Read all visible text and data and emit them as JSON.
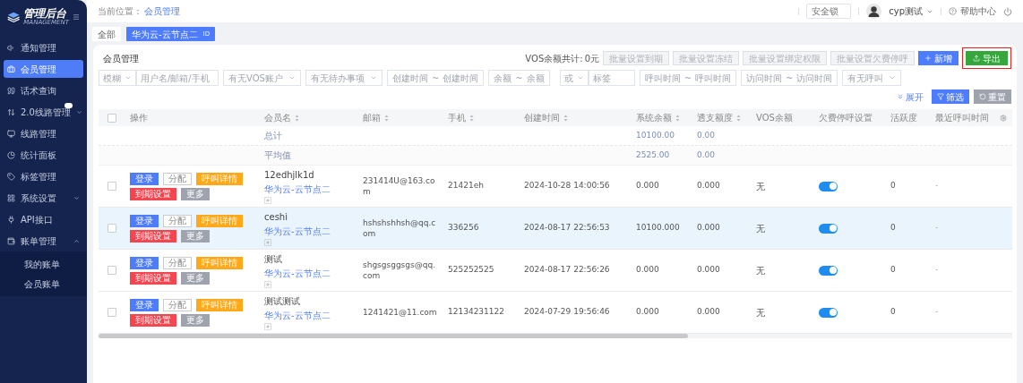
{
  "logo": {
    "title": "管理后台",
    "subtitle": "MANAGEMENT"
  },
  "sidebar": {
    "items": [
      {
        "label": "通知管理",
        "selected": false
      },
      {
        "label": "会员管理",
        "selected": true
      },
      {
        "label": "话术查询",
        "selected": false
      },
      {
        "label": "2.0线路管理",
        "selected": false,
        "expanded": false,
        "has_badge": true
      },
      {
        "label": "线路管理",
        "selected": false
      },
      {
        "label": "统计面板",
        "selected": false
      },
      {
        "label": "标签管理",
        "selected": false
      },
      {
        "label": "系统设置",
        "selected": false,
        "expanded": false
      },
      {
        "label": "API接口",
        "selected": false
      },
      {
        "label": "账单管理",
        "selected": false,
        "expanded": true,
        "children": [
          {
            "label": "我的账单",
            "selected": false
          },
          {
            "label": "会员账单",
            "selected": false
          }
        ]
      }
    ]
  },
  "header": {
    "breadcrumb_label": "当前位置：",
    "breadcrumb_current": "会员管理",
    "lock_field": {
      "value": "安全锁"
    },
    "user": "cyp测试",
    "help": "帮助中心"
  },
  "tabs": [
    {
      "label": "全部",
      "selected": false
    },
    {
      "label": "华为云-云节点二",
      "tag": "ID",
      "selected": true
    }
  ],
  "card": {
    "title": "会员管理",
    "vos_total_label": "VOS余额共计:",
    "vos_total": "0元",
    "batch_buttons": [
      {
        "label": "批量设置到期",
        "disabled": true
      },
      {
        "label": "批量设置冻结",
        "disabled": true
      },
      {
        "label": "批量设置绑定权限",
        "disabled": true
      },
      {
        "label": "批量设置欠费停呼",
        "disabled": true
      }
    ],
    "add_button": "新增",
    "export_button": {
      "label": "导出",
      "highlighted": true
    }
  },
  "filters": [
    {
      "kind": "select",
      "value": "模糊"
    },
    {
      "kind": "input",
      "placeholder": "用户名/邮箱/手机"
    },
    {
      "kind": "dropdown",
      "placeholder": "有无VOS账户"
    },
    {
      "kind": "dropdown",
      "placeholder": "有无待办事项"
    },
    {
      "kind": "range",
      "from": "创建时间",
      "separator": "~",
      "to": "创建时间"
    },
    {
      "kind": "range",
      "from": "余额",
      "separator": "~",
      "to": "余额"
    },
    {
      "kind": "select",
      "value": "或"
    },
    {
      "kind": "input",
      "placeholder": "标签"
    },
    {
      "kind": "range",
      "from": "呼叫时间",
      "separator": "~",
      "to": "呼叫时间"
    },
    {
      "kind": "range",
      "from": "访问时间",
      "separator": "~",
      "to": "访问时间"
    },
    {
      "kind": "dropdown",
      "placeholder": "有无呼叫"
    }
  ],
  "filter_actions": {
    "expand": "展开",
    "filter": "筛选",
    "reset": "重置"
  },
  "table": {
    "header_checked": false,
    "columns": [
      {
        "label": "操作",
        "sortable": false
      },
      {
        "label": "会员名",
        "sortable": true
      },
      {
        "label": "邮箱",
        "sortable": true
      },
      {
        "label": "手机",
        "sortable": true
      },
      {
        "label": "创建时间",
        "sortable": true
      },
      {
        "label": "系统余额",
        "sortable": true
      },
      {
        "label": "透支额度",
        "sortable": true
      },
      {
        "label": "VOS余额",
        "sortable": false
      },
      {
        "label": "欠费停呼设置",
        "sortable": false
      },
      {
        "label": "活跃度",
        "sortable": false
      },
      {
        "label": "最近呼叫时间",
        "sortable": false
      }
    ],
    "summary_rows": [
      {
        "label": "总计",
        "system_balance": "10100.00",
        "overdraft": "0.00"
      },
      {
        "label": "平均值",
        "system_balance": "2525.00",
        "overdraft": "0.00"
      }
    ],
    "rows": [
      {
        "checked": false,
        "hovered": false,
        "actions": [
          {
            "label": "登录",
            "kind": "primary"
          },
          {
            "label": "分配",
            "kind": "outline"
          },
          {
            "label": "呼叫详情",
            "kind": "warning"
          },
          {
            "label": "到期设置",
            "kind": "danger"
          },
          {
            "label": "更多",
            "kind": "muted"
          }
        ],
        "name": "12edhjlk1d",
        "node": "华为云-云节点二",
        "email": "231414U@163.com",
        "phone": "21421eh",
        "created": "2024-10-28 14:00:56",
        "system_balance": "0.000",
        "overdraft": "0.000",
        "vos_balance": "无",
        "stop_on_arrears": true,
        "activity": "0",
        "last_call": "-"
      },
      {
        "checked": false,
        "hovered": true,
        "actions": [
          {
            "label": "登录",
            "kind": "primary"
          },
          {
            "label": "分配",
            "kind": "outline"
          },
          {
            "label": "呼叫详情",
            "kind": "warning"
          },
          {
            "label": "到期设置",
            "kind": "danger"
          },
          {
            "label": "更多",
            "kind": "muted"
          }
        ],
        "name": "ceshi",
        "node": "华为云-云节点二",
        "email": "hshshshhsh@qq.com",
        "phone": "336256",
        "created": "2024-08-17 22:56:53",
        "system_balance": "10100.000",
        "overdraft": "0.000",
        "vos_balance": "无",
        "stop_on_arrears": true,
        "activity": "0",
        "last_call": "-"
      },
      {
        "checked": false,
        "hovered": false,
        "actions": [
          {
            "label": "登录",
            "kind": "primary"
          },
          {
            "label": "分配",
            "kind": "outline"
          },
          {
            "label": "呼叫详情",
            "kind": "warning"
          },
          {
            "label": "到期设置",
            "kind": "danger"
          },
          {
            "label": "更多",
            "kind": "muted"
          }
        ],
        "name": "测试",
        "node": "华为云-云节点二",
        "email": "shgsgsggsgs@qq.com",
        "phone": "525252525",
        "created": "2024-08-17 22:56:26",
        "system_balance": "0.000",
        "overdraft": "0.000",
        "vos_balance": "无",
        "stop_on_arrears": true,
        "activity": "0",
        "last_call": "-"
      },
      {
        "checked": false,
        "hovered": false,
        "actions": [
          {
            "label": "登录",
            "kind": "primary"
          },
          {
            "label": "分配",
            "kind": "outline"
          },
          {
            "label": "呼叫详情",
            "kind": "warning"
          },
          {
            "label": "到期设置",
            "kind": "danger"
          },
          {
            "label": "更多",
            "kind": "muted"
          }
        ],
        "name": "测试测试",
        "node": "华为云-云节点二",
        "email": "1241421@11.com",
        "phone": "12134231122",
        "created": "2024-07-29 19:56:46",
        "system_balance": "0.000",
        "overdraft": "0.000",
        "vos_balance": "无",
        "stop_on_arrears": true,
        "activity": "0",
        "last_call": "-"
      }
    ]
  }
}
